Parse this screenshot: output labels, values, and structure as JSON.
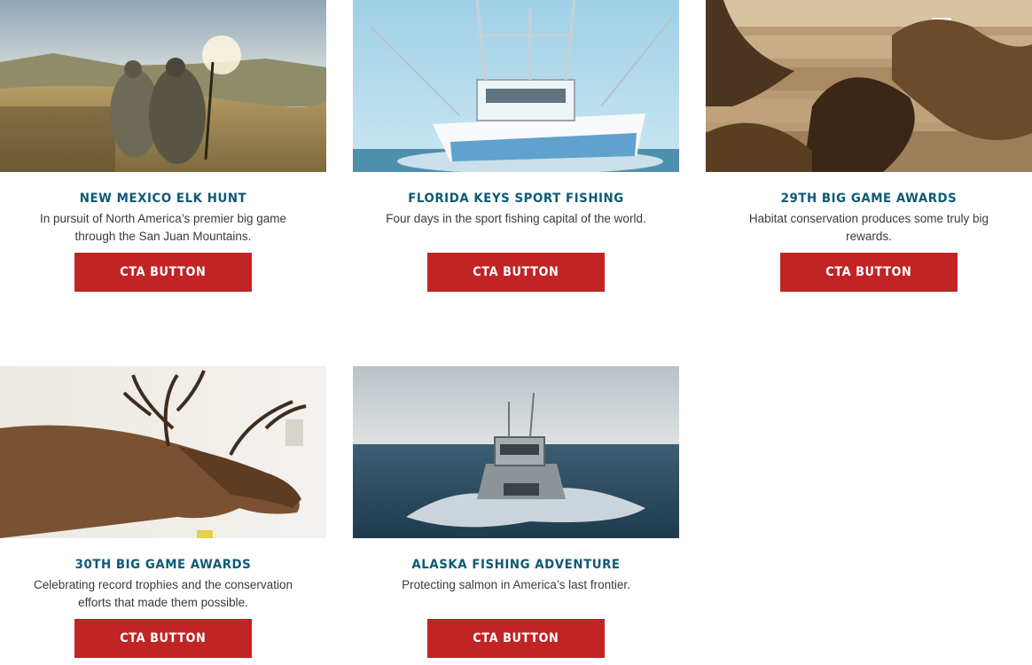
{
  "cards": [
    {
      "title": "NEW MEXICO ELK HUNT",
      "description": "In pursuit of North America’s premier big game through the San Juan Mountains.",
      "cta_label": "CTA BUTTON",
      "image_subject": "hunters-in-camo-walking-field"
    },
    {
      "title": "FLORIDA KEYS SPORT FISHING",
      "description": "Four days in the sport fishing capital of the world.",
      "cta_label": "CTA BUTTON",
      "image_subject": "sport-fishing-boat-on-ocean"
    },
    {
      "title": "29TH BIG GAME AWARDS",
      "description": "Habitat conservation produces some truly big rewards.",
      "cta_label": "CTA BUTTON",
      "image_subject": "moose-mounts-on-log-wall"
    },
    {
      "title": "30TH BIG GAME AWARDS",
      "description": "Celebrating record trophies and the conservation efforts that made them possible.",
      "cta_label": "CTA BUTTON",
      "image_subject": "bull-elk-mount"
    },
    {
      "title": "ALASKA FISHING ADVENTURE",
      "description": "Protecting salmon in America’s last frontier.",
      "cta_label": "CTA BUTTON",
      "image_subject": "aluminum-boat-speeding-on-water"
    }
  ],
  "colors": {
    "title": "#0c5a76",
    "cta_background": "#c02424",
    "cta_text": "#ffffff",
    "body_text": "#3a3a3a"
  }
}
